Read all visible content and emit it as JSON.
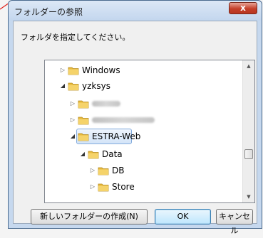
{
  "window": {
    "title": "フォルダーの参照",
    "close_label": "x"
  },
  "instruction": "フォルダを指定してください。",
  "tree": {
    "items": [
      {
        "label": "Windows",
        "expanded": false
      },
      {
        "label": "yzksys",
        "expanded": true
      },
      {
        "label": "",
        "expanded": false,
        "obscured": true
      },
      {
        "label": "",
        "expanded": false,
        "obscured": true
      },
      {
        "label": "ESTRA-Web",
        "expanded": true,
        "selected": true
      },
      {
        "label": "Data",
        "expanded": true
      },
      {
        "label": "DB",
        "expanded": false
      },
      {
        "label": "Store",
        "expanded": false
      }
    ]
  },
  "buttons": {
    "new_folder": "新しいフォルダーの作成(N)",
    "ok": "OK",
    "cancel": "キャンセル"
  },
  "colors": {
    "title_close": "#c4402a",
    "folder": "#e8b93c",
    "selection_border": "#84acdd",
    "annotation_mark": "#e0201a"
  }
}
